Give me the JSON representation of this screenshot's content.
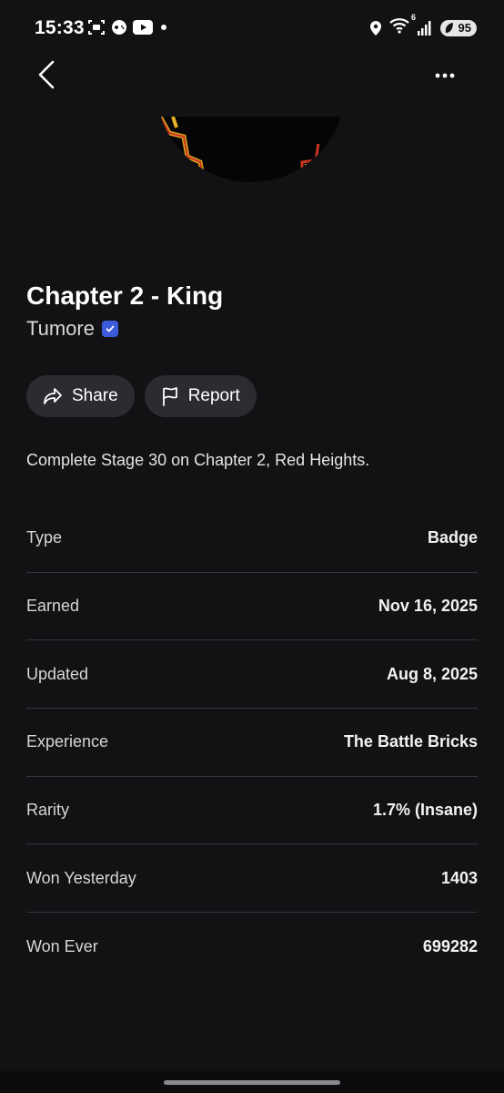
{
  "status_bar": {
    "time": "15:33",
    "battery": "95",
    "wifi_badge": "6"
  },
  "achievement": {
    "title": "Chapter 2 - King",
    "creator": "Tumore",
    "description": "Complete Stage 30 on Chapter 2, Red Heights."
  },
  "actions": {
    "share_label": "Share",
    "report_label": "Report"
  },
  "details": [
    {
      "label": "Type",
      "value": "Badge"
    },
    {
      "label": "Earned",
      "value": "Nov 16, 2025"
    },
    {
      "label": "Updated",
      "value": "Aug 8, 2025"
    },
    {
      "label": "Experience",
      "value": "The Battle Bricks"
    },
    {
      "label": "Rarity",
      "value": "1.7% (Insane)"
    },
    {
      "label": "Won Yesterday",
      "value": "1403"
    },
    {
      "label": "Won Ever",
      "value": "699282"
    }
  ],
  "colors": {
    "background": "#121215",
    "pill": "#2b2c31",
    "verified": "#3b5bdb",
    "divider": "#34353a"
  },
  "icons": [
    "back-icon",
    "more-options-icon",
    "share-icon",
    "flag-icon",
    "verified-icon"
  ]
}
